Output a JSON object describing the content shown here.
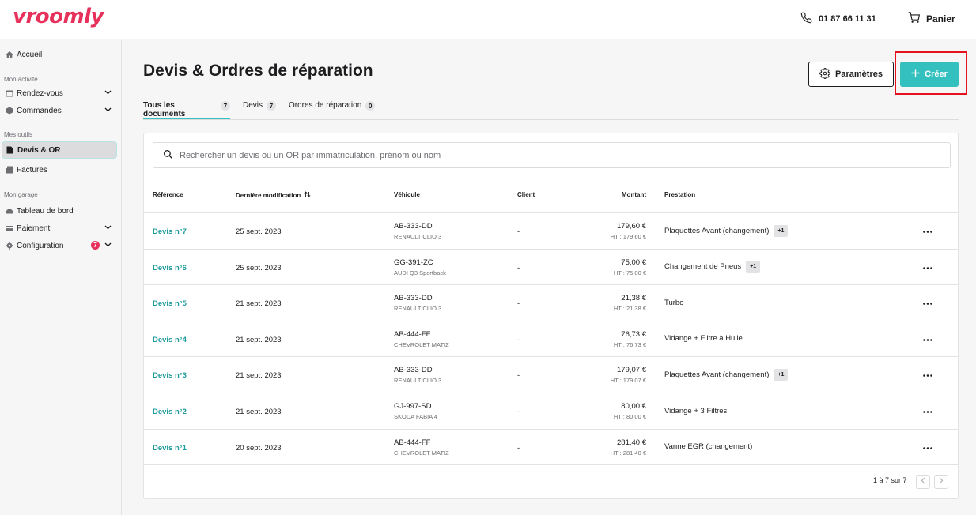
{
  "brand": {
    "logo": "vroomly",
    "color": "#e6315b"
  },
  "header": {
    "phone": "01 87 66 11 31",
    "cart_label": "Panier"
  },
  "sidebar": {
    "home": "Accueil",
    "section_activity": "Mon activité",
    "appointments": "Rendez-vous",
    "orders": "Commandes",
    "section_tools": "Mes outils",
    "quotes": "Devis & OR",
    "invoices": "Factures",
    "section_garage": "Mon garage",
    "dashboard": "Tableau de bord",
    "payment": "Paiement",
    "configuration": "Configuration",
    "configuration_badge": "7"
  },
  "page": {
    "title": "Devis & Ordres de réparation",
    "params_button": "Paramètres",
    "create_button": "Créer",
    "accent": "#35c0c0"
  },
  "tabs": [
    {
      "label": "Tous les documents",
      "count": "7"
    },
    {
      "label": "Devis",
      "count": "7"
    },
    {
      "label": "Ordres de réparation",
      "count": "0"
    }
  ],
  "search": {
    "placeholder": "Rechercher un devis ou un OR par immatriculation, prénom ou nom"
  },
  "table": {
    "headers": {
      "reference": "Référence",
      "modified": "Dernière modification",
      "vehicle": "Véhicule",
      "client": "Client",
      "amount": "Montant",
      "service": "Prestation"
    },
    "rows": [
      {
        "ref": "Devis n°7",
        "date": "25 sept. 2023",
        "plate": "AB-333-DD",
        "model": "RENAULT CLIO 3",
        "client": "-",
        "amount": "179,60 €",
        "ht": "HT : 179,60 €",
        "service": "Plaquettes Avant (changement)",
        "extra": "+1"
      },
      {
        "ref": "Devis n°6",
        "date": "25 sept. 2023",
        "plate": "GG-391-ZC",
        "model": "AUDI Q3 Sportback",
        "client": "-",
        "amount": "75,00 €",
        "ht": "HT : 75,00 €",
        "service": "Changement de Pneus",
        "extra": "+1"
      },
      {
        "ref": "Devis n°5",
        "date": "21 sept. 2023",
        "plate": "AB-333-DD",
        "model": "RENAULT CLIO 3",
        "client": "-",
        "amount": "21,38 €",
        "ht": "HT : 21,38 €",
        "service": "Turbo",
        "extra": ""
      },
      {
        "ref": "Devis n°4",
        "date": "21 sept. 2023",
        "plate": "AB-444-FF",
        "model": "CHEVROLET MATIZ",
        "client": "-",
        "amount": "76,73 €",
        "ht": "HT : 76,73 €",
        "service": "Vidange + Filtre à Huile",
        "extra": ""
      },
      {
        "ref": "Devis n°3",
        "date": "21 sept. 2023",
        "plate": "AB-333-DD",
        "model": "RENAULT CLIO 3",
        "client": "-",
        "amount": "179,07 €",
        "ht": "HT : 179,07 €",
        "service": "Plaquettes Avant (changement)",
        "extra": "+1"
      },
      {
        "ref": "Devis n°2",
        "date": "21 sept. 2023",
        "plate": "GJ-997-SD",
        "model": "SKODA FABIA 4",
        "client": "-",
        "amount": "80,00 €",
        "ht": "HT : 80,00 €",
        "service": "Vidange + 3 Filtres",
        "extra": ""
      },
      {
        "ref": "Devis n°1",
        "date": "20 sept. 2023",
        "plate": "AB-444-FF",
        "model": "CHEVROLET MATIZ",
        "client": "-",
        "amount": "281,40 €",
        "ht": "HT : 281,40 €",
        "service": "Vanne EGR (changement)",
        "extra": ""
      }
    ]
  },
  "pagination": {
    "label": "1 à 7 sur 7"
  }
}
